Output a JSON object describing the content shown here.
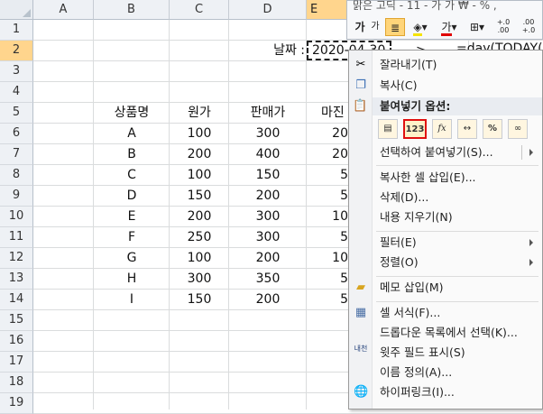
{
  "columns": [
    "A",
    "B",
    "C",
    "D",
    "E"
  ],
  "rows": [
    "1",
    "2",
    "3",
    "4",
    "5",
    "6",
    "7",
    "8",
    "9",
    "10",
    "11",
    "12",
    "13",
    "14",
    "15",
    "16",
    "17",
    "18",
    "19"
  ],
  "date_label": "날짜 :",
  "date_value": "2020-04-30",
  "arrow_text": "->",
  "formula_text": "=day(TODAY()",
  "table": {
    "headers": [
      "상품명",
      "원가",
      "판매가",
      "마진"
    ],
    "rows": [
      [
        "A",
        "100",
        "300",
        "20"
      ],
      [
        "B",
        "200",
        "400",
        "20"
      ],
      [
        "C",
        "100",
        "150",
        "5"
      ],
      [
        "D",
        "150",
        "200",
        "5"
      ],
      [
        "E",
        "200",
        "300",
        "10"
      ],
      [
        "F",
        "250",
        "300",
        "5"
      ],
      [
        "G",
        "100",
        "200",
        "10"
      ],
      [
        "H",
        "300",
        "350",
        "5"
      ],
      [
        "I",
        "150",
        "200",
        "5"
      ]
    ]
  },
  "mini_toolbar": {
    "row1_text": "맑은 고딕 - 11 - 가 가 ₩ - % ,",
    "font_grow": "가",
    "font_shrink": "가",
    "font_color_label": "가",
    "dec_inc": "+.0 .00",
    "dec_dec": ".00 +.0"
  },
  "context_menu": {
    "items": [
      {
        "label": "잘라내기(T)",
        "icon": "scissors-icon"
      },
      {
        "label": "복사(C)",
        "icon": "copy-icon"
      }
    ],
    "paste_header": "붙여넣기 옵션:",
    "paste_buttons": [
      {
        "name": "paste-all",
        "glyph": ""
      },
      {
        "name": "paste-values",
        "glyph": "123"
      },
      {
        "name": "paste-formulas",
        "glyph": "fx"
      },
      {
        "name": "paste-transpose",
        "glyph": "↔"
      },
      {
        "name": "paste-formatting",
        "glyph": "%"
      },
      {
        "name": "paste-link",
        "glyph": "∞"
      }
    ],
    "paste_special": "선택하여 붙여넣기(S)...",
    "items2": [
      {
        "label": "복사한 셀 삽입(E)..."
      },
      {
        "label": "삭제(D)..."
      },
      {
        "label": "내용 지우기(N)"
      }
    ],
    "items3": [
      {
        "label": "필터(E)",
        "submenu": true
      },
      {
        "label": "정렬(O)",
        "submenu": true
      }
    ],
    "memo": "메모 삽입(M)",
    "items4": [
      {
        "label": "셀 서식(F)...",
        "icon": "format-cells-icon"
      },
      {
        "label": "드롭다운 목록에서 선택(K)...",
        "icon": ""
      },
      {
        "label": "윗주 필드 표시(S)",
        "icon": "phonetic-icon",
        "glyph": "내천"
      },
      {
        "label": "이름 정의(A)...",
        "icon": ""
      },
      {
        "label": "하이퍼링크(I)...",
        "icon": "hyperlink-icon"
      }
    ]
  },
  "colors": {
    "header_selected": "#ffd58d",
    "highlight_border": "#e01010",
    "gridline": "#dadcdd"
  }
}
